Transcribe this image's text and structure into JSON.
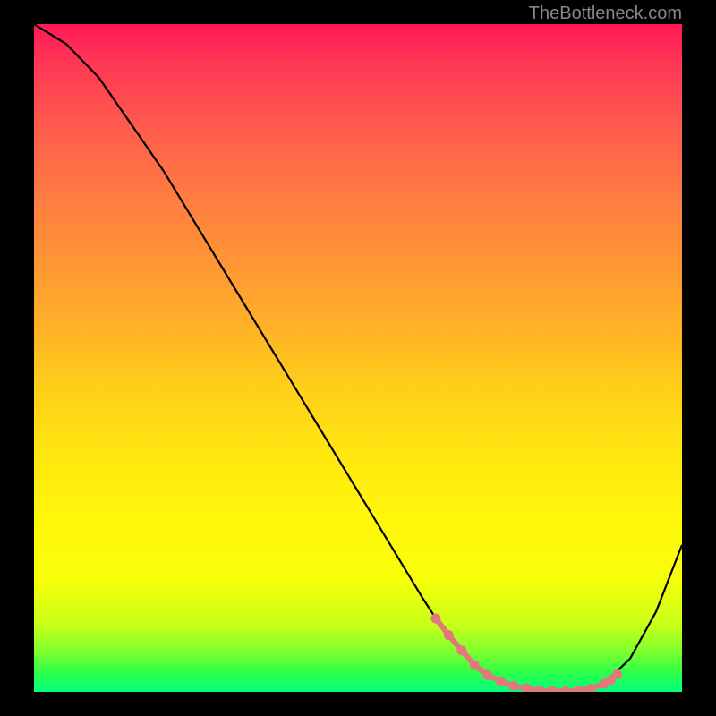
{
  "watermark": "TheBottleneck.com",
  "chart_data": {
    "type": "line",
    "title": "",
    "xlabel": "",
    "ylabel": "",
    "xlim": [
      0,
      100
    ],
    "ylim": [
      0,
      100
    ],
    "grid": false,
    "legend": false,
    "background_gradient": {
      "type": "vertical",
      "stops": [
        {
          "pos": 0,
          "color": "#ff1a55"
        },
        {
          "pos": 0.5,
          "color": "#ffc020"
        },
        {
          "pos": 0.85,
          "color": "#fff80a"
        },
        {
          "pos": 1.0,
          "color": "#00ff7d"
        }
      ]
    },
    "series": [
      {
        "name": "bottleneck-curve",
        "color": "#000000",
        "x": [
          0,
          5,
          10,
          15,
          20,
          25,
          30,
          35,
          40,
          45,
          50,
          55,
          60,
          62,
          65,
          68,
          70,
          73,
          76,
          78,
          80,
          82,
          84,
          86,
          88,
          92,
          96,
          100
        ],
        "y": [
          100,
          97,
          92,
          85,
          78,
          70,
          62,
          54,
          46,
          38,
          30,
          22,
          14,
          11,
          7,
          4,
          2.5,
          1.2,
          0.5,
          0.2,
          0.1,
          0.1,
          0.2,
          0.5,
          1.2,
          5,
          12,
          22
        ]
      }
    ],
    "markers": {
      "name": "highlighted-range",
      "color": "#e07a7a",
      "x": [
        62,
        64,
        66,
        68,
        70,
        72,
        74,
        76,
        78,
        80,
        82,
        84,
        86,
        88,
        89,
        90
      ],
      "y": [
        11,
        8.5,
        6.2,
        4,
        2.5,
        1.6,
        0.9,
        0.5,
        0.2,
        0.1,
        0.1,
        0.2,
        0.5,
        1.2,
        1.8,
        2.6
      ]
    }
  }
}
